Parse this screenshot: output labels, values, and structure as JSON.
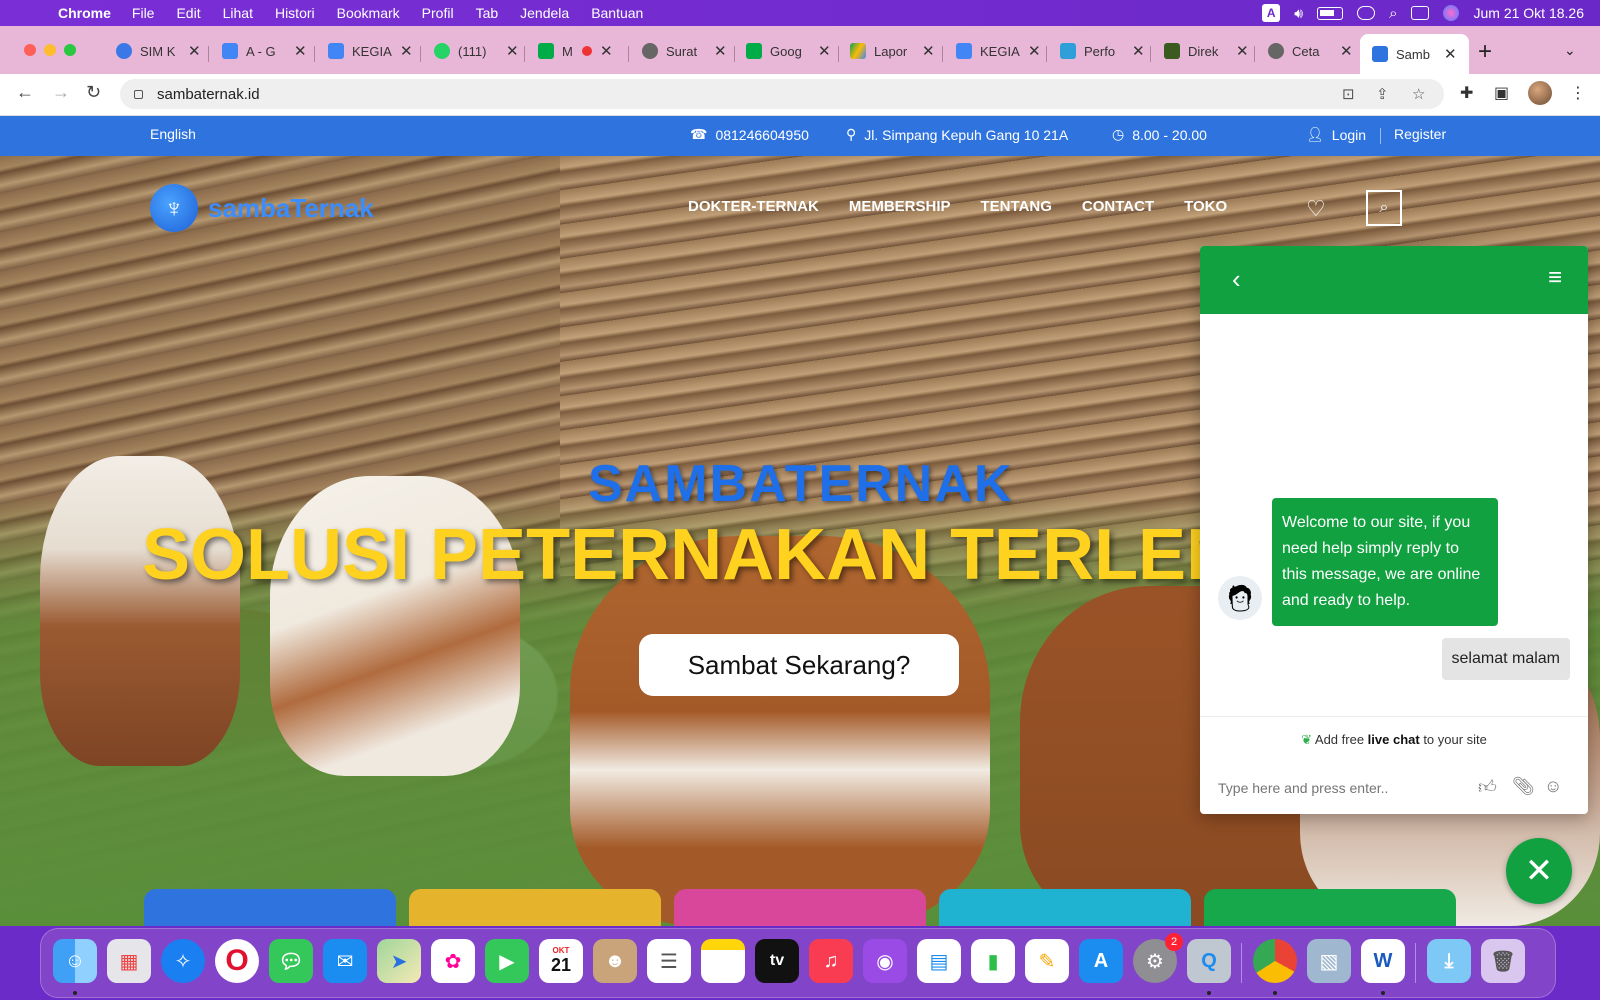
{
  "menubar": {
    "app": "Chrome",
    "items": [
      "File",
      "Edit",
      "Lihat",
      "Histori",
      "Bookmark",
      "Profil",
      "Tab",
      "Jendela",
      "Bantuan"
    ],
    "input_badge": "A",
    "clock": "Jum 21 Okt  18.26"
  },
  "tabs": [
    {
      "title": "SIM K",
      "icon": "globe-icon"
    },
    {
      "title": "A - G",
      "icon": "docs-icon"
    },
    {
      "title": "KEGIA",
      "icon": "docs-icon"
    },
    {
      "title": "(111)",
      "icon": "whatsapp-icon"
    },
    {
      "title": "M",
      "icon": "meet-icon"
    },
    {
      "title": "Surat",
      "icon": "globe-icon"
    },
    {
      "title": "Goog",
      "icon": "meet-icon"
    },
    {
      "title": "Lapor",
      "icon": "drive-icon"
    },
    {
      "title": "KEGIA",
      "icon": "docs-icon"
    },
    {
      "title": "Perfo",
      "icon": "site-icon"
    },
    {
      "title": "Direk",
      "icon": "site-icon"
    },
    {
      "title": "Ceta",
      "icon": "globe-icon"
    },
    {
      "title": "Samb",
      "icon": "site-icon"
    }
  ],
  "address_bar": {
    "url": "sambaternak.id"
  },
  "site": {
    "topbar": {
      "language": "English",
      "phone": "081246604950",
      "address": "Jl. Simpang Kepuh Gang 10 21A",
      "hours": "8.00 - 20.00",
      "login": "Login",
      "register": "Register"
    },
    "logo_text": "sambaTernak",
    "nav": [
      "DOKTER-TERNAK",
      "MEMBERSHIP",
      "TENTANG",
      "CONTACT",
      "TOKO"
    ],
    "hero": {
      "subtitle": "SAMBATERNAK",
      "title": "SOLUSI PETERNAKAN TERLENGKAP",
      "cta": "Sambat Sekarang?"
    },
    "card_colors": [
      "#2f74de",
      "#e6b42c",
      "#d9479a",
      "#1fb3d1",
      "#16a84a"
    ]
  },
  "chat": {
    "welcome": "Welcome to our site, if you need help simply reply to this message, we are online and ready to help.",
    "user_message": "selamat malam",
    "powered_prefix": "Add free ",
    "powered_bold": "live chat",
    "powered_suffix": " to your site",
    "input_placeholder": "Type here and press enter.."
  },
  "dock": {
    "calendar_month": "OKT",
    "calendar_day": "21",
    "tv_label": "tv",
    "settings_badge": "2"
  },
  "colors": {
    "topbar_blue": "#2f74de",
    "chat_green": "#12a141",
    "hero_yellow": "#ffd21f",
    "hero_blue": "#1e6fe8"
  }
}
